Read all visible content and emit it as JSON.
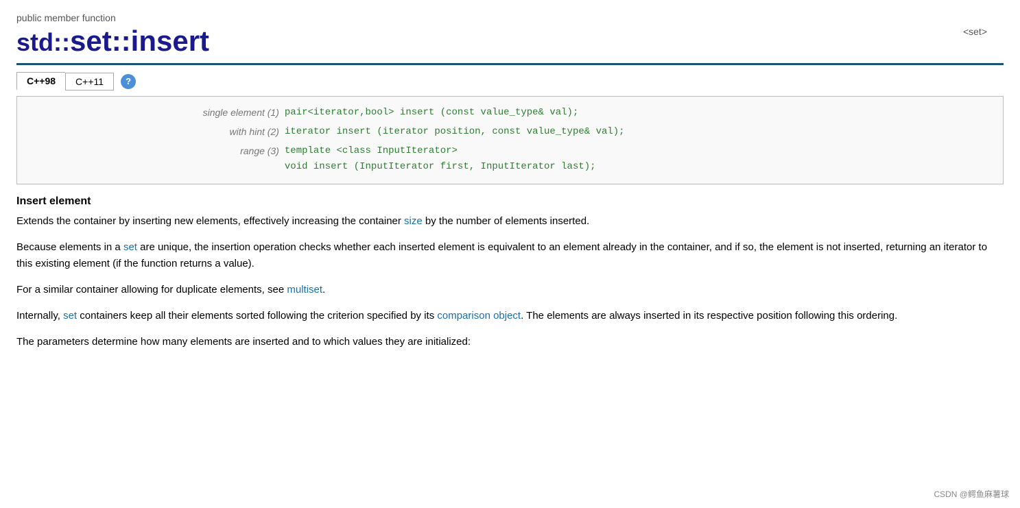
{
  "nav": {
    "top_link": "<set>"
  },
  "header": {
    "public_member_label": "public member function",
    "title_prefix": "std::",
    "title_fn": "set::insert"
  },
  "tabs": [
    {
      "label": "C++98",
      "active": true
    },
    {
      "label": "C++11",
      "active": false
    }
  ],
  "help_icon_label": "?",
  "code_rows": [
    {
      "label": "single element (1)",
      "code": "pair<iterator,bool> insert (const value_type& val);"
    },
    {
      "label": "with hint (2)",
      "code": "iterator insert (iterator position, const value_type& val);"
    },
    {
      "label": "range (3)",
      "code_line1": "template <class InputIterator>",
      "code_line2": "    void insert (InputIterator first, InputIterator last);"
    }
  ],
  "section_heading": "Insert element",
  "paragraphs": [
    {
      "text": "Extends the container by inserting new elements, effectively increasing the container ",
      "link": "size",
      "text_after": " by the number of elements inserted."
    },
    {
      "text": "Because elements in a ",
      "link1": "set",
      "text2": " are unique, the insertion operation checks whether each inserted element is equivalent to an element already in the container, and if so, the element is not inserted, returning an iterator to this existing element (if the function returns a value)."
    },
    {
      "text": "For a similar container allowing for duplicate elements, see ",
      "link": "multiset",
      "text_after": "."
    },
    {
      "text": "Internally, ",
      "link1": "set",
      "text2": " containers keep all their elements sorted following the criterion specified by its ",
      "link2": "comparison object",
      "text3": ". The elements are always inserted in its respective position following this ordering."
    },
    {
      "text": "The parameters determine how many elements are inserted and to which values they are initialized:"
    }
  ],
  "watermark": "CSDN @鳄鱼麻薯球"
}
